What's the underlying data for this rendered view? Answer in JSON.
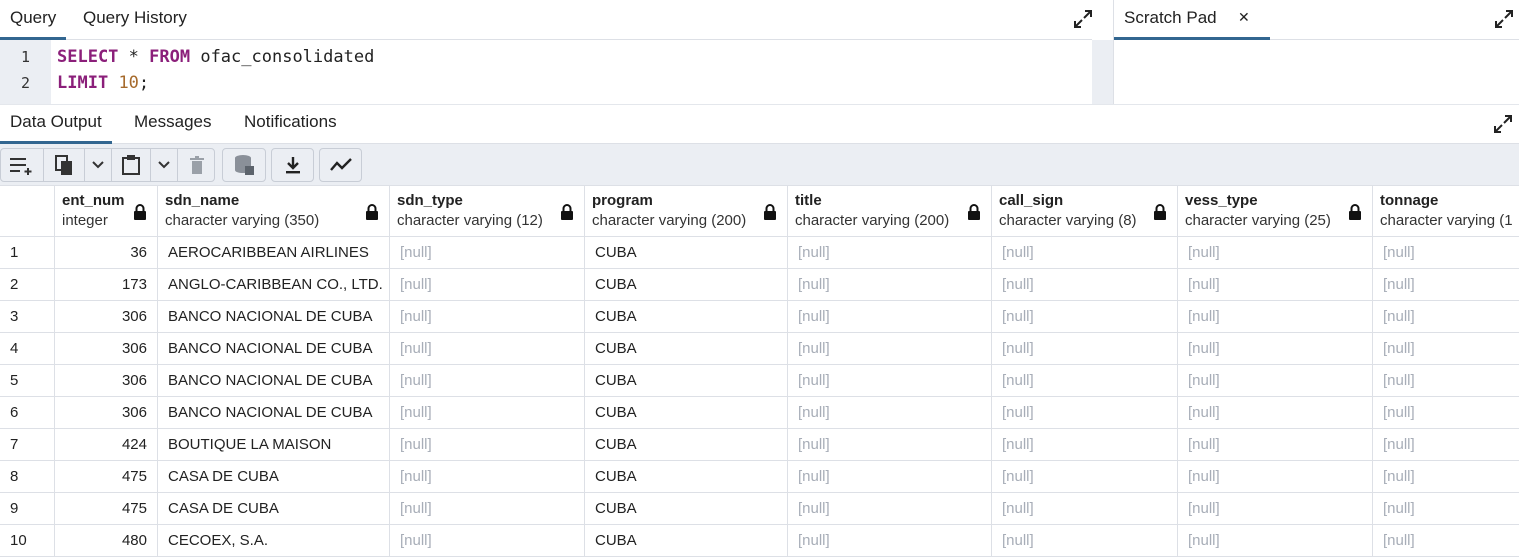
{
  "query_panel": {
    "tabs": [
      {
        "label": "Query",
        "active": true
      },
      {
        "label": "Query History",
        "active": false
      }
    ],
    "editor": {
      "lines": [
        {
          "number": "1",
          "tokens": [
            {
              "text": "SELECT",
              "kind": "kw"
            },
            {
              "text": " * ",
              "kind": "plain"
            },
            {
              "text": "FROM",
              "kind": "kw"
            },
            {
              "text": " ofac_consolidated",
              "kind": "plain"
            }
          ]
        },
        {
          "number": "2",
          "tokens": [
            {
              "text": "LIMIT",
              "kind": "kw"
            },
            {
              "text": " ",
              "kind": "plain"
            },
            {
              "text": "10",
              "kind": "num"
            },
            {
              "text": ";",
              "kind": "plain"
            }
          ]
        }
      ]
    }
  },
  "scratch_panel": {
    "tab_label": "Scratch Pad",
    "close_glyph": "✕"
  },
  "result_panel": {
    "tabs": [
      {
        "label": "Data Output",
        "active": true
      },
      {
        "label": "Messages",
        "active": false
      },
      {
        "label": "Notifications",
        "active": false
      }
    ]
  },
  "toolbar_icons": [
    "add-row-icon",
    "copy-icon",
    "chevron-down-icon",
    "paste-icon",
    "chevron-down-icon",
    "delete-icon",
    "save-data-icon",
    "download-icon",
    "graph-icon"
  ],
  "columns": [
    {
      "name": "ent_num",
      "type": "integer"
    },
    {
      "name": "sdn_name",
      "type": "character varying (350)"
    },
    {
      "name": "sdn_type",
      "type": "character varying (12)"
    },
    {
      "name": "program",
      "type": "character varying (200)"
    },
    {
      "name": "title",
      "type": "character varying (200)"
    },
    {
      "name": "call_sign",
      "type": "character varying (8)"
    },
    {
      "name": "vess_type",
      "type": "character varying (25)"
    },
    {
      "name": "tonnage",
      "type": "character varying (1"
    }
  ],
  "rows": [
    {
      "n": "1",
      "cells": [
        "36",
        "AEROCARIBBEAN AIRLINES",
        "[null]",
        "CUBA",
        "[null]",
        "[null]",
        "[null]",
        "[null]"
      ]
    },
    {
      "n": "2",
      "cells": [
        "173",
        "ANGLO-CARIBBEAN CO., LTD.",
        "[null]",
        "CUBA",
        "[null]",
        "[null]",
        "[null]",
        "[null]"
      ]
    },
    {
      "n": "3",
      "cells": [
        "306",
        "BANCO NACIONAL DE CUBA",
        "[null]",
        "CUBA",
        "[null]",
        "[null]",
        "[null]",
        "[null]"
      ]
    },
    {
      "n": "4",
      "cells": [
        "306",
        "BANCO NACIONAL DE CUBA",
        "[null]",
        "CUBA",
        "[null]",
        "[null]",
        "[null]",
        "[null]"
      ]
    },
    {
      "n": "5",
      "cells": [
        "306",
        "BANCO NACIONAL DE CUBA",
        "[null]",
        "CUBA",
        "[null]",
        "[null]",
        "[null]",
        "[null]"
      ]
    },
    {
      "n": "6",
      "cells": [
        "306",
        "BANCO NACIONAL DE CUBA",
        "[null]",
        "CUBA",
        "[null]",
        "[null]",
        "[null]",
        "[null]"
      ]
    },
    {
      "n": "7",
      "cells": [
        "424",
        "BOUTIQUE LA MAISON",
        "[null]",
        "CUBA",
        "[null]",
        "[null]",
        "[null]",
        "[null]"
      ]
    },
    {
      "n": "8",
      "cells": [
        "475",
        "CASA DE CUBA",
        "[null]",
        "CUBA",
        "[null]",
        "[null]",
        "[null]",
        "[null]"
      ]
    },
    {
      "n": "9",
      "cells": [
        "475",
        "CASA DE CUBA",
        "[null]",
        "CUBA",
        "[null]",
        "[null]",
        "[null]",
        "[null]"
      ]
    },
    {
      "n": "10",
      "cells": [
        "480",
        "CECOEX, S.A.",
        "[null]",
        "CUBA",
        "[null]",
        "[null]",
        "[null]",
        "[null]"
      ]
    }
  ],
  "colors": {
    "accent": "#326690",
    "keyword": "#8b1f7a",
    "number": "#a66a2c",
    "null_text": "#a7adb7",
    "panel_bg": "#ebeef3"
  }
}
